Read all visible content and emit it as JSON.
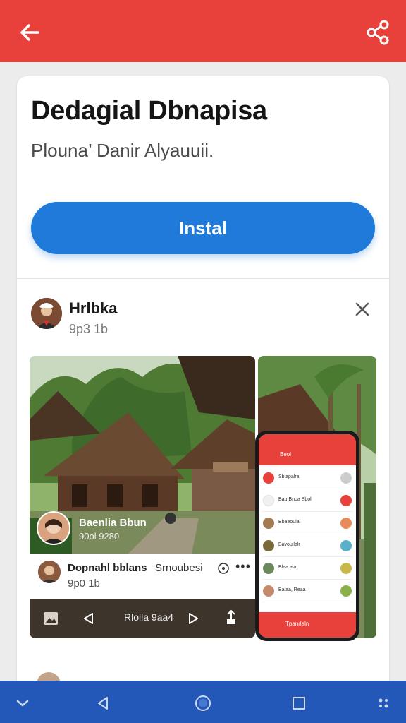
{
  "app": {
    "title": "Dedagial Dbnapisa",
    "subtitle": "Plouna’ Danir Alyauuii.",
    "install_label": "Instal"
  },
  "post": {
    "author": "Hrlbka",
    "time": "9p3 1b",
    "close_icon": "close-icon"
  },
  "screenshot1": {
    "overlay_name": "Baenlia Bbun",
    "overlay_meta": "90ol 9280",
    "row_name": "Dopnahl bblans",
    "row_extra": "Srnoubesi",
    "row_meta": "9p0 1b",
    "player_label": "Rlolla 9aa4"
  },
  "screenshot2": {
    "phone_title": "Beol",
    "rows": [
      "Sblapalra",
      "Bau Bnoa Bbol",
      "Bbaeoulal",
      "Bavoullalr",
      "Blaa ala",
      "Balaa, Reaa"
    ],
    "bottom_label": "Tpanrlaln"
  },
  "colors": {
    "topbar": "#e8403a",
    "install_button": "#1f7ad9",
    "navbar": "#2357b8"
  },
  "icons": [
    "back-arrow-icon",
    "share-icon",
    "close-icon",
    "play-icon",
    "back-nav-icon",
    "home-nav-icon",
    "recents-nav-icon"
  ]
}
